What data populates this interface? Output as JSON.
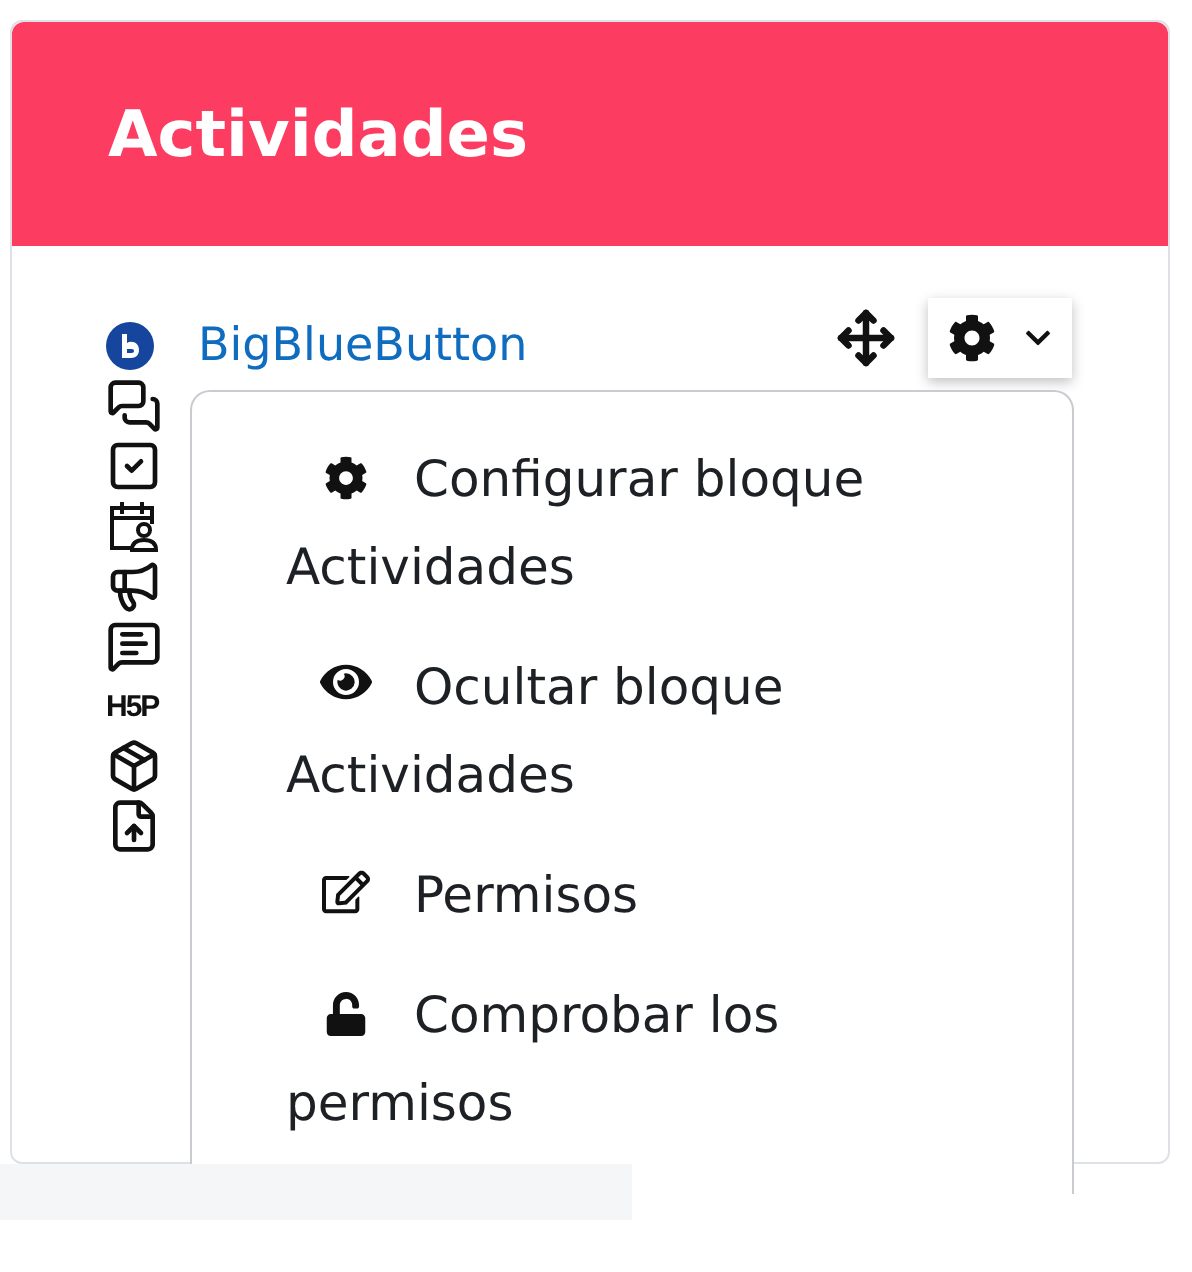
{
  "block": {
    "title": "Actividades"
  },
  "activities": [
    {
      "kind": "bigbluebutton",
      "label": "BigBlueButton"
    },
    {
      "kind": "chat"
    },
    {
      "kind": "assignment"
    },
    {
      "kind": "scheduler"
    },
    {
      "kind": "announcement"
    },
    {
      "kind": "feedback"
    },
    {
      "kind": "h5p",
      "logo_text": "H5P"
    },
    {
      "kind": "box"
    },
    {
      "kind": "upload"
    }
  ],
  "menu": [
    {
      "kind": "configure",
      "label": "Configurar bloque Actividades"
    },
    {
      "kind": "hide",
      "label": "Ocultar bloque Actividades"
    },
    {
      "kind": "permissions",
      "label": "Permisos"
    },
    {
      "kind": "check",
      "label": "Comprobar los permisos"
    }
  ]
}
